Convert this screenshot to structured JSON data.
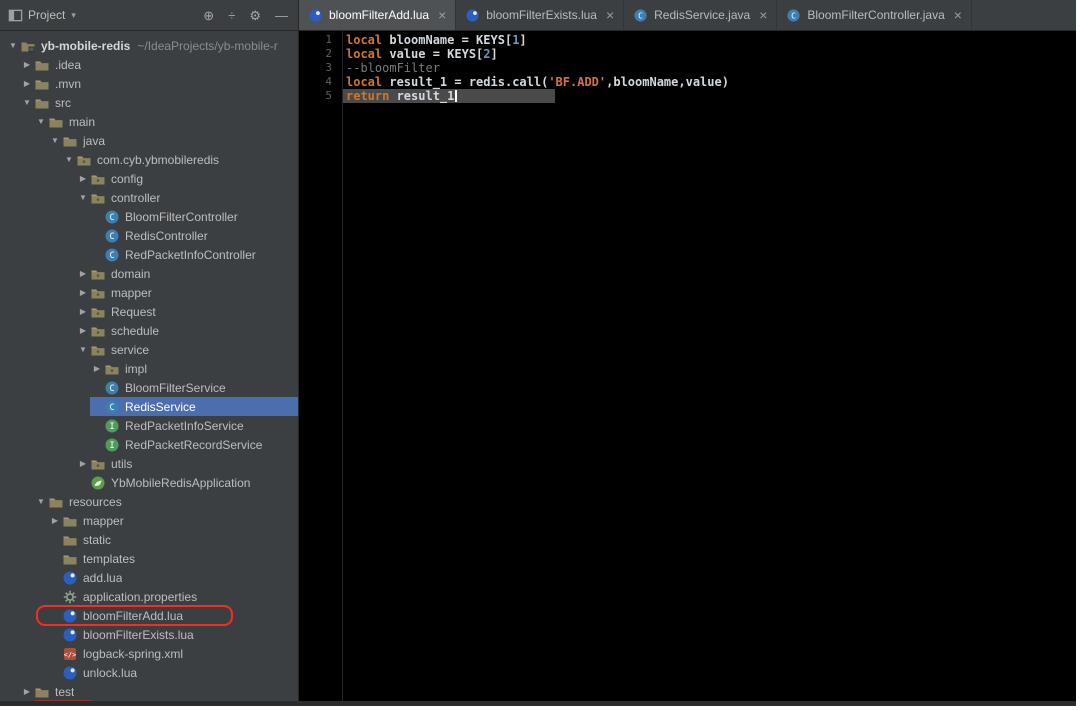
{
  "project_panel": {
    "header": {
      "title": "Project",
      "caret": "▾",
      "icons": {
        "locate": "⊕",
        "collapse": "÷",
        "settings": "⚙",
        "hide": "—"
      }
    },
    "chevron_glyphs": {
      "expanded": "▼",
      "collapsed": "▶"
    },
    "tree": [
      {
        "label": "yb-mobile-redis",
        "suffix": "~/IdeaProjects/yb-mobile-r",
        "level": 0,
        "chevron": "expanded",
        "icon": "project-folder",
        "bold": true
      },
      {
        "label": ".idea",
        "level": 1,
        "chevron": "collapsed",
        "icon": "folder"
      },
      {
        "label": ".mvn",
        "level": 1,
        "chevron": "collapsed",
        "icon": "folder"
      },
      {
        "label": "src",
        "level": 1,
        "chevron": "expanded",
        "icon": "folder"
      },
      {
        "label": "main",
        "level": 2,
        "chevron": "expanded",
        "icon": "folder"
      },
      {
        "label": "java",
        "level": 3,
        "chevron": "expanded",
        "icon": "folder"
      },
      {
        "label": "com.cyb.ybmobileredis",
        "level": 4,
        "chevron": "expanded",
        "icon": "package"
      },
      {
        "label": "config",
        "level": 5,
        "chevron": "collapsed",
        "icon": "package"
      },
      {
        "label": "controller",
        "level": 5,
        "chevron": "expanded",
        "icon": "package"
      },
      {
        "label": "BloomFilterController",
        "level": 6,
        "chevron": "none",
        "icon": "class"
      },
      {
        "label": "RedisController",
        "level": 6,
        "chevron": "none",
        "icon": "class"
      },
      {
        "label": "RedPacketInfoController",
        "level": 6,
        "chevron": "none",
        "icon": "class"
      },
      {
        "label": "domain",
        "level": 5,
        "chevron": "collapsed",
        "icon": "package"
      },
      {
        "label": "mapper",
        "level": 5,
        "chevron": "collapsed",
        "icon": "package"
      },
      {
        "label": "Request",
        "level": 5,
        "chevron": "collapsed",
        "icon": "package"
      },
      {
        "label": "schedule",
        "level": 5,
        "chevron": "collapsed",
        "icon": "package"
      },
      {
        "label": "service",
        "level": 5,
        "chevron": "expanded",
        "icon": "package"
      },
      {
        "label": "impl",
        "level": 6,
        "chevron": "collapsed",
        "icon": "package"
      },
      {
        "label": "BloomFilterService",
        "level": 6,
        "chevron": "none",
        "icon": "class"
      },
      {
        "label": "RedisService",
        "level": 6,
        "chevron": "none",
        "icon": "class",
        "selected": true
      },
      {
        "label": "RedPacketInfoService",
        "level": 6,
        "chevron": "none",
        "icon": "interface"
      },
      {
        "label": "RedPacketRecordService",
        "level": 6,
        "chevron": "none",
        "icon": "interface"
      },
      {
        "label": "utils",
        "level": 5,
        "chevron": "collapsed",
        "icon": "package"
      },
      {
        "label": "YbMobileRedisApplication",
        "level": 5,
        "chevron": "none",
        "icon": "spring"
      },
      {
        "label": "resources",
        "level": 2,
        "chevron": "expanded",
        "icon": "folder"
      },
      {
        "label": "mapper",
        "level": 3,
        "chevron": "collapsed",
        "icon": "folder"
      },
      {
        "label": "static",
        "level": 3,
        "chevron": "none",
        "icon": "folder"
      },
      {
        "label": "templates",
        "level": 3,
        "chevron": "none",
        "icon": "folder"
      },
      {
        "label": "add.lua",
        "level": 3,
        "chevron": "none",
        "icon": "lua"
      },
      {
        "label": "application.properties",
        "level": 3,
        "chevron": "none",
        "icon": "properties"
      },
      {
        "label": "bloomFilterAdd.lua",
        "level": 3,
        "chevron": "none",
        "icon": "lua",
        "annotated": true
      },
      {
        "label": "bloomFilterExists.lua",
        "level": 3,
        "chevron": "none",
        "icon": "lua"
      },
      {
        "label": "logback-spring.xml",
        "level": 3,
        "chevron": "none",
        "icon": "xml"
      },
      {
        "label": "unlock.lua",
        "level": 3,
        "chevron": "none",
        "icon": "lua"
      },
      {
        "label": "test",
        "level": 1,
        "chevron": "collapsed",
        "icon": "folder"
      }
    ]
  },
  "editor": {
    "close_glyph": "×",
    "tabs": [
      {
        "label": "bloomFilterAdd.lua",
        "icon": "lua",
        "active": true
      },
      {
        "label": "bloomFilterExists.lua",
        "icon": "lua",
        "active": false
      },
      {
        "label": "RedisService.java",
        "icon": "class",
        "active": false
      },
      {
        "label": "BloomFilterController.java",
        "icon": "class",
        "active": false
      }
    ],
    "code": {
      "lines": [
        {
          "num": "1",
          "tokens": [
            {
              "t": "local ",
              "c": "kw"
            },
            {
              "t": "bloomName = KEYS[",
              "c": "pl"
            },
            {
              "t": "1",
              "c": "num"
            },
            {
              "t": "]",
              "c": "pl"
            }
          ]
        },
        {
          "num": "2",
          "tokens": [
            {
              "t": "local ",
              "c": "kw"
            },
            {
              "t": "value = KEYS[",
              "c": "pl"
            },
            {
              "t": "2",
              "c": "num"
            },
            {
              "t": "]",
              "c": "pl"
            }
          ]
        },
        {
          "num": "3",
          "tokens": [
            {
              "t": "--bloomFilter",
              "c": "cm"
            }
          ]
        },
        {
          "num": "4",
          "tokens": [
            {
              "t": "local ",
              "c": "kw"
            },
            {
              "t": "result_1 = redis.",
              "c": "pl"
            },
            {
              "t": "call",
              "c": "fn"
            },
            {
              "t": "(",
              "c": "pl"
            },
            {
              "t": "'BF.ADD'",
              "c": "str"
            },
            {
              "t": ",bloomName,value)",
              "c": "pl"
            }
          ]
        },
        {
          "num": "5",
          "tokens": [
            {
              "t": "return ",
              "c": "kw"
            },
            {
              "t": "result_1",
              "c": "pl"
            }
          ],
          "current": true,
          "caret": true
        }
      ]
    }
  },
  "colors": {
    "selection": "#4b6eaf",
    "annotation_red": "#f32f23",
    "keyword": "#cc7832",
    "string": "#d5714b",
    "number": "#6897bb",
    "comment": "#7a7a7a",
    "plain_code": "#d2d8de",
    "editor_bg": "#000000",
    "panel_bg": "#3c3f41"
  }
}
